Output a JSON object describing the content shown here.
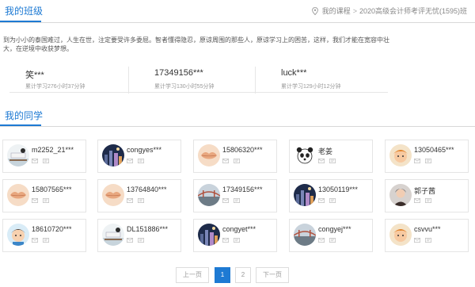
{
  "header": {
    "title": "我的班级",
    "breadcrumb": {
      "link": "我的课程",
      "separator": ">",
      "current": "2020高级会计师考评无忧(1595)班"
    }
  },
  "motto": "到为小小的泰国难过，人生在世，注定要受许多委屈。智者懂得隐忍，原谅周围的那些人，原谅学习上的困苦，这样，我们才能在宽容中壮大，在逆境中收获梦想。",
  "top_students": [
    {
      "name": "笑***",
      "study_time": "累计学习276小时37分钟"
    },
    {
      "name": "17349156***",
      "study_time": "累计学习130小时55分钟"
    },
    {
      "name": "luck***",
      "study_time": "累计学习129小时12分钟"
    }
  ],
  "classmates": {
    "title": "我的同学",
    "list": [
      {
        "name": "m2252_21***",
        "avatar": "dock-scene"
      },
      {
        "name": "congyes***",
        "avatar": "night-city"
      },
      {
        "name": "15806320***",
        "avatar": "lips"
      },
      {
        "name": "老姜",
        "avatar": "panda"
      },
      {
        "name": "13050465***",
        "avatar": "cartoon-boy"
      },
      {
        "name": "15807565***",
        "avatar": "lips"
      },
      {
        "name": "13764840***",
        "avatar": "lips"
      },
      {
        "name": "17349156***",
        "avatar": "bridge"
      },
      {
        "name": "13050119***",
        "avatar": "night-city"
      },
      {
        "name": "郭子茜",
        "avatar": "portrait-dark"
      },
      {
        "name": "18610720***",
        "avatar": "cartoon-boy-blue"
      },
      {
        "name": "DL151886***",
        "avatar": "dock-scene"
      },
      {
        "name": "congyet***",
        "avatar": "night-city"
      },
      {
        "name": "congyej***",
        "avatar": "bridge"
      },
      {
        "name": "csvvu***",
        "avatar": "cartoon-boy"
      }
    ]
  },
  "pagination": {
    "prev": "上一页",
    "pages": [
      "1",
      "2"
    ],
    "current": "1",
    "next": "下一页"
  },
  "colors": {
    "accent": "#1e7ad3",
    "border": "#e5e5e5"
  },
  "icons": {
    "breadcrumb": "location-pin-icon",
    "card_actions": [
      "mail-icon",
      "message-icon"
    ]
  }
}
